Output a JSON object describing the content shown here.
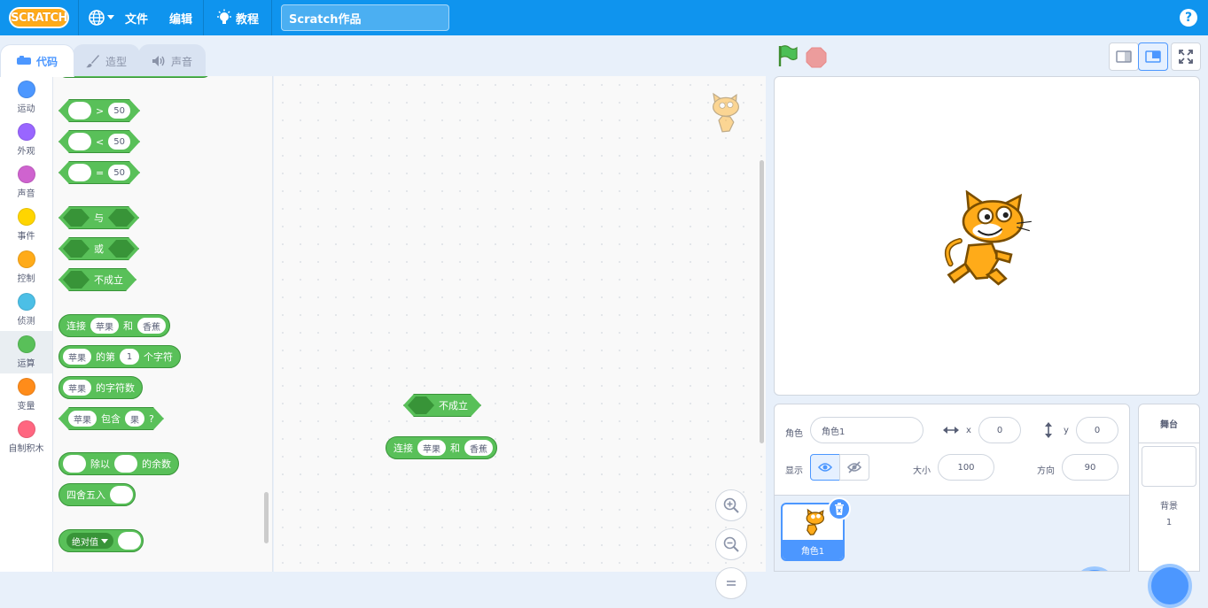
{
  "menubar": {
    "logo": "SCRATCH",
    "file": "文件",
    "edit": "编辑",
    "tutorials": "教程",
    "project_title": "Scratch作品",
    "help": "?"
  },
  "tabs": {
    "code": "代码",
    "costumes": "造型",
    "sounds": "声音"
  },
  "categories": [
    {
      "label": "运动",
      "color": "#4c97ff"
    },
    {
      "label": "外观",
      "color": "#9966ff"
    },
    {
      "label": "声音",
      "color": "#cf63cf"
    },
    {
      "label": "事件",
      "color": "#ffd500"
    },
    {
      "label": "控制",
      "color": "#ffab19"
    },
    {
      "label": "侦测",
      "color": "#4cbfe6"
    },
    {
      "label": "运算",
      "color": "#59c059"
    },
    {
      "label": "变量",
      "color": "#ff8c1a"
    },
    {
      "label": "自制积木",
      "color": "#ff6680"
    }
  ],
  "palette": {
    "gt_op": ">",
    "gt_val": "50",
    "lt_op": "<",
    "lt_val": "50",
    "eq_op": "=",
    "eq_val": "50",
    "and": "与",
    "or": "或",
    "not": "不成立",
    "join": {
      "label": "连接",
      "a": "苹果",
      "and": "和",
      "b": "香蕉"
    },
    "letter_of": {
      "a": "苹果",
      "of": "的第",
      "n": "1",
      "char": "个字符"
    },
    "length_of": {
      "a": "苹果",
      "label": "的字符数"
    },
    "contains": {
      "a": "苹果",
      "label": "包含",
      "b": "果",
      "q": "?"
    },
    "mod": {
      "label": "除以",
      "label2": "的余数"
    },
    "round": "四舍五入",
    "abs": "绝对值"
  },
  "script": {
    "not": "不成立",
    "join": {
      "label": "连接",
      "a": "苹果",
      "and": "和",
      "b": "香蕉"
    }
  },
  "sprite_info": {
    "sprite_label": "角色",
    "sprite_name": "角色1",
    "x_label": "x",
    "x_value": "0",
    "y_label": "y",
    "y_value": "0",
    "show_label": "显示",
    "size_label": "大小",
    "size_value": "100",
    "direction_label": "方向",
    "direction_value": "90",
    "thumb_name": "角色1"
  },
  "stage_panel": {
    "title": "舞台",
    "backdrop_label": "背景",
    "backdrop_count": "1"
  },
  "colors": {
    "menubar": "#0f94ee",
    "operators": "#59c059",
    "accent": "#4c97ff"
  }
}
